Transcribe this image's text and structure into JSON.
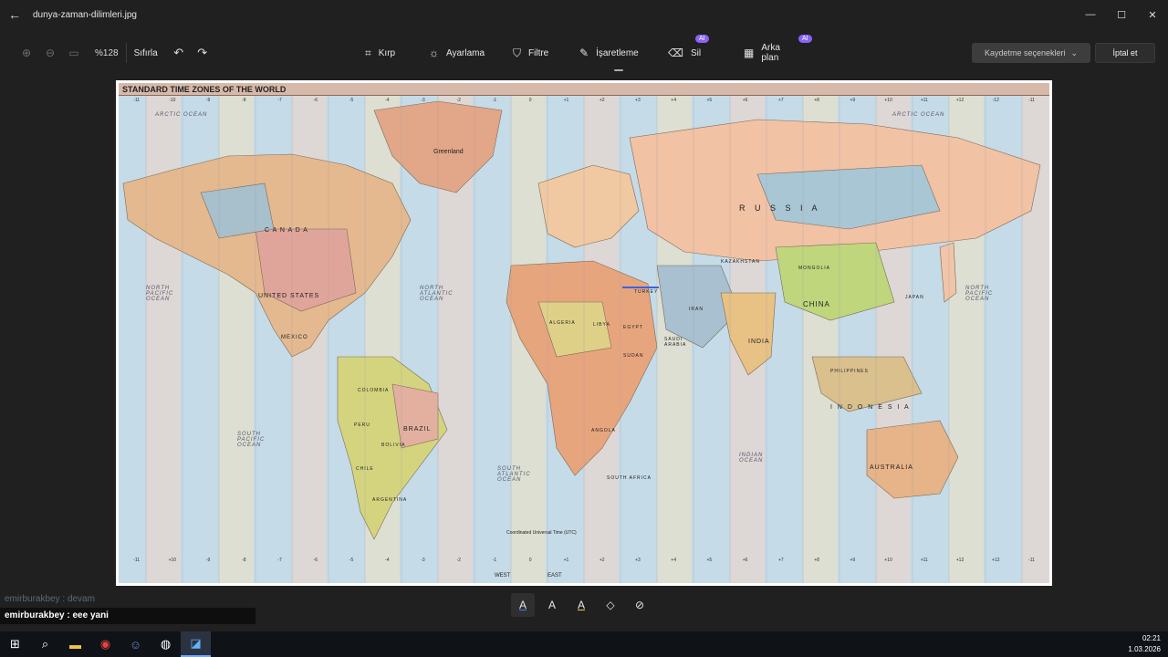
{
  "window": {
    "title": "dunya-zaman-dilimleri.jpg",
    "controls": {
      "minimize": "—",
      "maximize": "☐",
      "close": "✕"
    }
  },
  "toolbar": {
    "zoom_value": "%128",
    "reset_label": "Sıfırla",
    "tools": [
      {
        "label": "Kırp",
        "icon": "crop-icon",
        "glyph": "⌗"
      },
      {
        "label": "Ayarlama",
        "icon": "brightness-icon",
        "glyph": "☼"
      },
      {
        "label": "Filtre",
        "icon": "filter-icon",
        "glyph": "⛉"
      },
      {
        "label": "İşaretleme",
        "icon": "markup-pen-icon",
        "glyph": "✎"
      },
      {
        "label": "Sil",
        "icon": "erase-icon",
        "glyph": "⌫",
        "badge": "AI"
      },
      {
        "label": "Arka plan",
        "icon": "background-icon",
        "glyph": "▦",
        "badge": "AI"
      }
    ],
    "save_label": "Kaydetme seçenekleri",
    "cancel_label": "İptal et"
  },
  "map": {
    "title": "STANDARD TIME ZONES OF THE WORLD",
    "zones_top": [
      "-11",
      "-10",
      "-9",
      "-8",
      "-7",
      "-6",
      "-5",
      "-4",
      "-3",
      "-2",
      "-1",
      "0",
      "+1",
      "+2",
      "+3",
      "+4",
      "+5",
      "+6",
      "+7",
      "+8",
      "+9",
      "+10",
      "+11",
      "+12",
      "-12",
      "-11"
    ],
    "zones_bottom": [
      "-11",
      "+10",
      "-9",
      "-8",
      "-7",
      "-6",
      "-5",
      "-4",
      "-3",
      "-2",
      "-1",
      "0",
      "+1",
      "+2",
      "+3",
      "+4",
      "+5",
      "+6",
      "+7",
      "+8",
      "+9",
      "+10",
      "+11",
      "+12",
      "+12",
      "-11"
    ],
    "labels": {
      "canada": "C A N A D A",
      "united_states": "UNITED STATES",
      "mexico": "MEXICO",
      "brazil": "BRAZIL",
      "argentina": "ARGENTINA",
      "greenland": "Greenland",
      "russia": "R U S S I A",
      "china": "CHINA",
      "india": "INDIA",
      "mongolia": "MONGOLIA",
      "kazakhstan": "KAZAKHSTAN",
      "australia": "AUSTRALIA",
      "indonesia": "I N D O N E S I A",
      "algeria": "ALGERIA",
      "libya": "LIBYA",
      "egypt": "EGYPT",
      "sudan": "SUDAN",
      "iran": "IRAN",
      "saudi_arabia": "SAUDI ARABIA",
      "turkey": "TURKEY",
      "angola": "ANGOLA",
      "south_africa": "SOUTH AFRICA",
      "philippines": "PHILIPPINES",
      "japan": "JAPAN",
      "peru": "PERU",
      "bolivia": "BOLIVIA",
      "colombia": "COLOMBIA",
      "chile": "CHILE"
    },
    "oceans": {
      "arctic_left": "ARCTIC OCEAN",
      "arctic_right": "ARCTIC OCEAN",
      "north_pacific": "NORTH PACIFIC OCEAN",
      "north_pacific_right": "NORTH PACIFIC OCEAN",
      "north_atlantic": "NORTH ATLANTIC OCEAN",
      "south_pacific": "SOUTH PACIFIC OCEAN",
      "south_atlantic": "SOUTH ATLANTIC OCEAN",
      "indian": "INDIAN OCEAN"
    },
    "west_label": "WEST",
    "east_label": "EAST",
    "utc_note": "Coordinated Universal Time (UTC)"
  },
  "drawbar": {
    "tools": [
      {
        "glyph": "A",
        "icon": "ballpoint-pen-icon"
      },
      {
        "glyph": "A",
        "icon": "pencil-icon"
      },
      {
        "glyph": "A",
        "icon": "highlighter-icon"
      },
      {
        "glyph": "◇",
        "icon": "eraser-icon"
      },
      {
        "glyph": "⊘",
        "icon": "clear-ink-icon"
      }
    ]
  },
  "chat": [
    {
      "user": "emirburakbey",
      "sep": " : ",
      "text": "devam"
    },
    {
      "user": "emirburakbey",
      "sep": " : ",
      "text": "eee yani"
    }
  ],
  "taskbar": {
    "time": "02:21",
    "date": "1.03.2026",
    "apps": [
      {
        "icon": "windows-start-icon",
        "glyph": "⊞"
      },
      {
        "icon": "search-icon",
        "glyph": "⌕"
      },
      {
        "icon": "file-explorer-icon",
        "glyph": "▬"
      },
      {
        "icon": "chrome-icon",
        "glyph": "◉"
      },
      {
        "icon": "discord-icon",
        "glyph": "☺"
      },
      {
        "icon": "obs-icon",
        "glyph": "◍"
      },
      {
        "icon": "photos-icon",
        "glyph": "◪"
      }
    ]
  },
  "colors": {
    "background": "#202020",
    "accent": "#8a63f7",
    "ocean": "#bcd6e4"
  }
}
